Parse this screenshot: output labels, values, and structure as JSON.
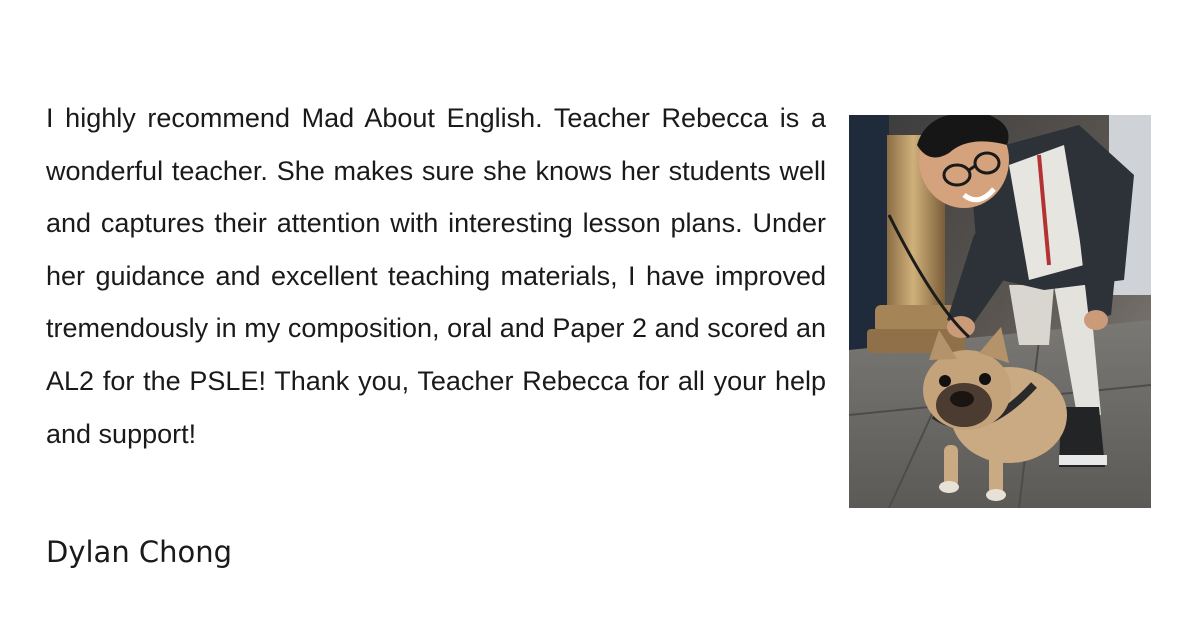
{
  "testimonial": {
    "text": "I highly recommend Mad About English. Teacher Rebecca is a wonderful teacher. She makes sure she knows her students well and captures their attention with interesting lesson plans. Under her guidance and excellent teaching materials, I have improved tremendously in my composition, oral and Paper 2 and scored an AL2 for the PSLE! Thank you, Teacher Rebecca for all your help and support!",
    "author": "Dylan Chong"
  },
  "photo": {
    "icon": "photo-boy-with-french-bulldog"
  }
}
